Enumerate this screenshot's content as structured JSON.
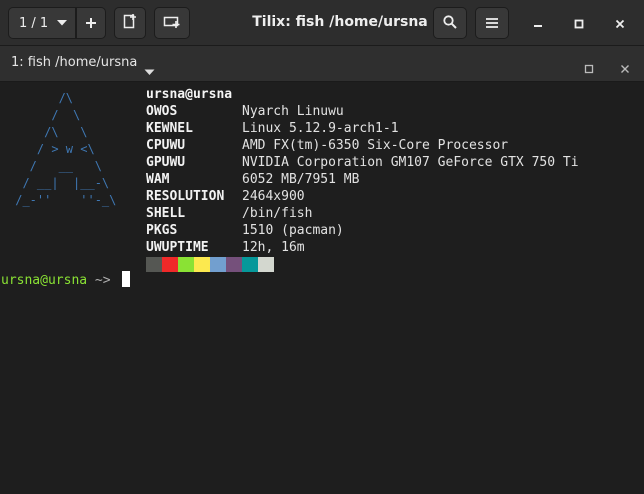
{
  "headerbar": {
    "session_indicator": "1 / 1",
    "title": "Tilix: fish /home/ursna"
  },
  "tab": {
    "title": "1: fish /home/ursna"
  },
  "neofetch": {
    "ascii_art": "       /\\\n      /  \\\n     /\\   \\\n    / > w <\\\n   /   __   \\\n  / __|  |__-\\\n /_-''    ''-_\\",
    "user_host": "ursna@ursna",
    "rows": [
      {
        "key": "OWOS",
        "value": "Nyarch Linuwu"
      },
      {
        "key": "KEWNEL",
        "value": "Linux 5.12.9-arch1-1"
      },
      {
        "key": "CPUWU",
        "value": "AMD FX(tm)-6350 Six-Core Processor"
      },
      {
        "key": "GPUWU",
        "value": "NVIDIA Corporation GM107 GeForce GTX 750 Ti"
      },
      {
        "key": "WAM",
        "value": "6052 MB/7951 MB"
      },
      {
        "key": "RESOLUTION",
        "value": "2464x900"
      },
      {
        "key": "SHELL",
        "value": "/bin/fish"
      },
      {
        "key": "PKGS",
        "value": "1510 (pacman)"
      },
      {
        "key": "UWUPTIME",
        "value": "12h, 16m"
      }
    ],
    "palette": [
      "#555753",
      "#ef2929",
      "#8ae234",
      "#fce94f",
      "#729fcf",
      "#75507b",
      "#06989a",
      "#d3d7cf"
    ]
  },
  "prompt": {
    "user": "ursna@ursna",
    "path": "~>"
  },
  "colors": {
    "accent_ascii": "#3f78b4",
    "prompt_green": "#8ae234",
    "background": "#1e1e1e"
  }
}
